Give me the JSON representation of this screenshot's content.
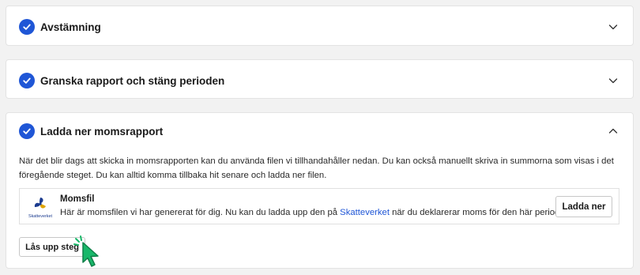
{
  "sections": {
    "reconciliation": {
      "title": "Avstämning",
      "state": "collapsed"
    },
    "review": {
      "title": "Granska rapport och stäng perioden",
      "state": "collapsed"
    },
    "download": {
      "title": "Ladda ner momsrapport",
      "state": "expanded",
      "description": "När det blir dags att skicka in momsrapporten kan du använda filen vi tillhandahåller nedan. Du kan också manuellt skriva in summorna som visas i det föregående steget. Du kan alltid komma tillbaka hit senare och ladda ner filen.",
      "file": {
        "logo_text": "Skatteverket",
        "name": "Momsfil",
        "text_before": "Här är momsfilen vi har genererat för dig. Nu kan du ladda upp den på ",
        "link_text": "Skatteverket",
        "text_after": " när du deklarerar moms för den här perioden.",
        "button_label": "Ladda ner"
      },
      "unlock_label": "Lås upp steg"
    }
  },
  "icons": {
    "check": "check-icon",
    "collapsed": "chevron-down-icon",
    "expanded": "chevron-up-icon",
    "cursor": "pointer-cursor-icon"
  },
  "colors": {
    "accent": "#1f56d6",
    "cursor": "#18b86a",
    "background": "#f2f2f2"
  }
}
